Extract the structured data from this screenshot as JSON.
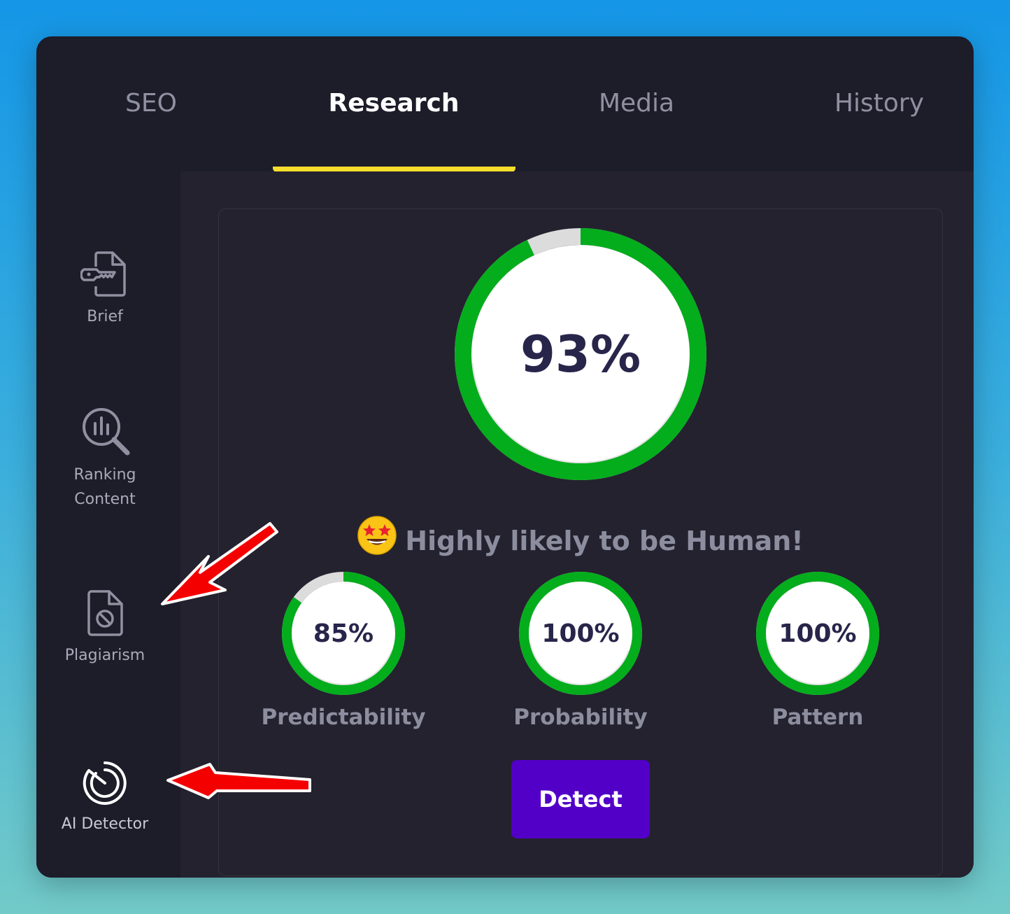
{
  "tabs": [
    {
      "label": "SEO",
      "active": false
    },
    {
      "label": "Research",
      "active": true
    },
    {
      "label": "Media",
      "active": false
    },
    {
      "label": "History",
      "active": false
    }
  ],
  "sidebar": {
    "items": [
      {
        "label": "Brief",
        "icon": "key-document-icon"
      },
      {
        "label": "Ranking Content",
        "icon": "chart-magnifier-icon"
      },
      {
        "label": "Plagiarism",
        "icon": "document-blocked-icon"
      },
      {
        "label": "AI Detector",
        "icon": "detector-target-icon",
        "active": true
      }
    ]
  },
  "main_score": {
    "value": 93,
    "label": "93%"
  },
  "verdict": {
    "emoji": "star-struck-emoji",
    "text": "Highly likely to be Human!"
  },
  "metrics": [
    {
      "name": "Predictability",
      "value": 85,
      "label": "85%"
    },
    {
      "name": "Probability",
      "value": 100,
      "label": "100%"
    },
    {
      "name": "Pattern",
      "value": 100,
      "label": "100%"
    }
  ],
  "detect_button": {
    "label": "Detect"
  },
  "colors": {
    "progress": "#04ad1c",
    "track": "#dcdcdc",
    "accent_underline": "#f7dd2e",
    "button": "#5200c8",
    "annotation_arrow": "#f40000"
  }
}
